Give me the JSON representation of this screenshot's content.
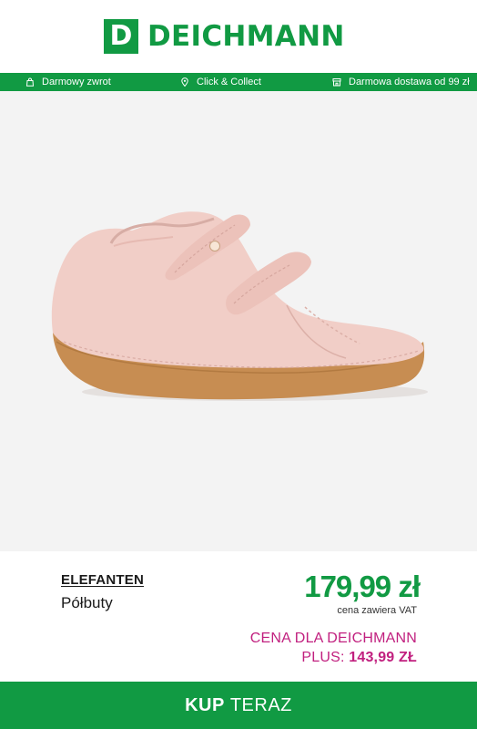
{
  "header": {
    "logo_letter": "D",
    "logo_text": "DEICHMANN",
    "brand_color": "#119a43"
  },
  "usp_bar": {
    "items": [
      {
        "label": "Darmowy zwrot",
        "icon": "bag-icon"
      },
      {
        "label": "Click & Collect",
        "icon": "location-pin-icon"
      },
      {
        "label": "Darmowa dostawa od 99 zł",
        "icon": "store-icon"
      }
    ]
  },
  "product": {
    "image": "pink-baby-shoe-velcro-image",
    "brand": "ELEFANTEN",
    "category": "Półbuty",
    "price": "179,99 zł",
    "vat_note": "cena zawiera VAT",
    "plus_label_line1": "CENA DLA DEICHMANN",
    "plus_label_line2_prefix": "PLUS:",
    "plus_price": "143,99 ZŁ",
    "price_color": "#119a43",
    "plus_color": "#c1207f"
  },
  "cta": {
    "label_bold": "KUP",
    "label_rest": "TERAZ"
  }
}
